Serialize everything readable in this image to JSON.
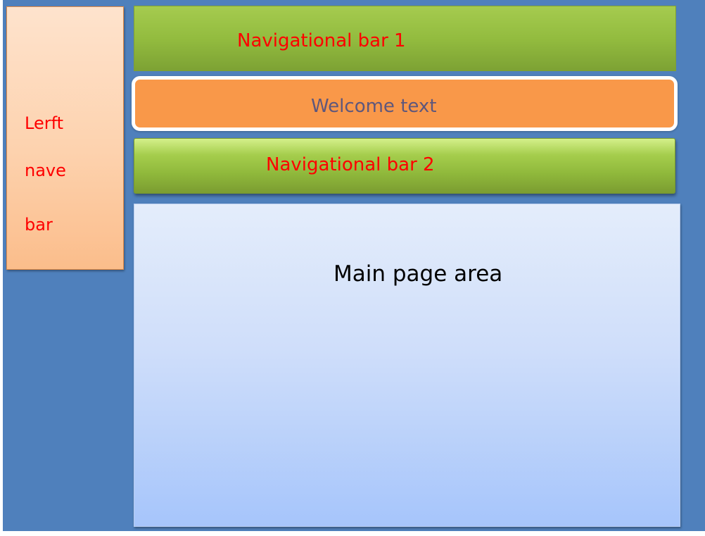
{
  "left_nav": {
    "lines": [
      "Lerft",
      "nave",
      "bar"
    ]
  },
  "nav_bar_1": {
    "label": "Navigational bar 1"
  },
  "welcome": {
    "label": "Welcome text"
  },
  "nav_bar_2": {
    "label": "Navigational bar 2"
  },
  "main_area": {
    "label": "Main page area"
  },
  "colors": {
    "background": "#4f80bc",
    "nav_bar_green": "#93bc3f",
    "welcome_orange": "#f99849",
    "left_nav_peach": "#fdd2ae",
    "main_area_blue": "#cfdefa",
    "label_red": "#fe0000",
    "welcome_text": "#5e577c"
  }
}
